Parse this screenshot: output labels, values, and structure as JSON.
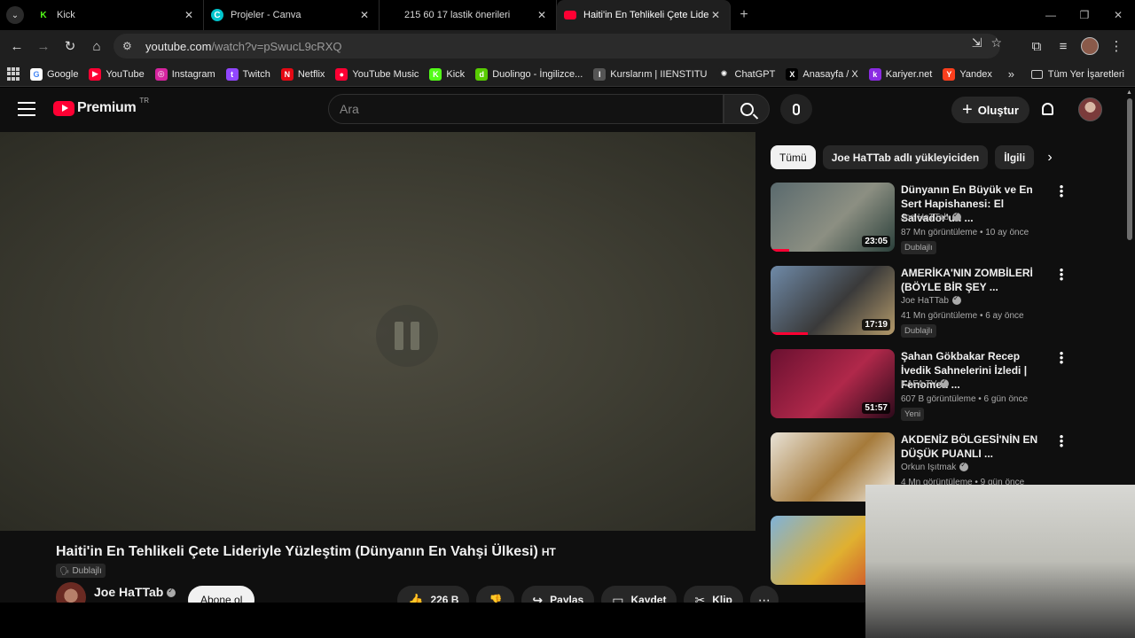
{
  "browser": {
    "tabs": [
      {
        "title": "Kick",
        "favicon_label": "K",
        "favicon_color": "#53fc18",
        "active": false
      },
      {
        "title": "Projeler - Canva",
        "favicon_label": "C",
        "favicon_color": "#00c4cc",
        "active": false
      },
      {
        "title": "215 60 17 lastik önerileri",
        "favicon_label": "",
        "favicon_color": "#000000",
        "active": false
      },
      {
        "title": "Haiti'in En Tehlikeli Çete Lideriy",
        "favicon_label": "",
        "favicon_color": "#ff0033",
        "active": true
      }
    ],
    "url_host": "youtube.com",
    "url_path": "/watch?v=pSwucL9cRXQ",
    "bookmarks": [
      {
        "label": "Google",
        "icon_color": "#ffffff",
        "icon_label": "G"
      },
      {
        "label": "YouTube",
        "icon_color": "#ff0033",
        "icon_label": "▶"
      },
      {
        "label": "Instagram",
        "icon_color": "#d6249f",
        "icon_label": "◎"
      },
      {
        "label": "Twitch",
        "icon_color": "#9146ff",
        "icon_label": "t"
      },
      {
        "label": "Netflix",
        "icon_color": "#e50914",
        "icon_label": "N"
      },
      {
        "label": "YouTube Music",
        "icon_color": "#ff0033",
        "icon_label": "●"
      },
      {
        "label": "Kick",
        "icon_color": "#53fc18",
        "icon_label": "K"
      },
      {
        "label": "Duolingo - İngilizce...",
        "icon_color": "#58cc02",
        "icon_label": "d"
      },
      {
        "label": "Kurslarım | IIENSTITU",
        "icon_color": "#555555",
        "icon_label": "I"
      },
      {
        "label": "ChatGPT",
        "icon_color": "#1f1f1f",
        "icon_label": "✺"
      },
      {
        "label": "Anasayfa / X",
        "icon_color": "#000000",
        "icon_label": "X"
      },
      {
        "label": "Kariyer.net",
        "icon_color": "#8a2be2",
        "icon_label": "k"
      },
      {
        "label": "Yandex",
        "icon_color": "#fc3f1d",
        "icon_label": "Y"
      }
    ],
    "bookmarks_more": "»",
    "all_bookmarks": "Tüm Yer İşaretleri"
  },
  "youtube": {
    "logo_word": "Premium",
    "country_code": "TR",
    "search_placeholder": "Ara",
    "create_label": "Oluştur",
    "video": {
      "title": "Haiti'in En Tehlikeli Çete Lideriyle Yüzleştim (Dünyanın En Vahşi Ülkesi)",
      "hashtag": "HT",
      "dub_badge": "Dublajlı",
      "channel": "Joe HaTTab",
      "subscribe": "Abone ol",
      "likes": "226 B",
      "share": "Paylaş",
      "save": "Kaydet",
      "clip": "Klip"
    },
    "chips": [
      "Tümü",
      "Joe HaTTab adlı yükleyiciden",
      "İlgili"
    ],
    "recommendations": [
      {
        "title": "Dünyanın En Büyük ve En Sert Hapishanesi: El Salvador'un ...",
        "channel": "Joe HaTTab",
        "verified": true,
        "meta": "87 Mn görüntüleme • 10 ay önce",
        "badge": "Dublajlı",
        "duration": "23:05",
        "progress": 0.15,
        "thumb_colors": [
          "#5a6a6e",
          "#8c8f82",
          "#2a3f3a"
        ]
      },
      {
        "title": "AMERİKA'NIN ZOMBİLERİ (BÖYLE BİR ŞEY ...",
        "channel": "Joe HaTTab",
        "verified": true,
        "meta": "41 Mn görüntüleme • 6 ay önce",
        "badge": "Dublajlı",
        "duration": "17:19",
        "progress": 0.3,
        "thumb_colors": [
          "#6f8aa8",
          "#3a3a3a",
          "#b49a6a"
        ]
      },
      {
        "title": "Şahan Gökbakar Recep İvedik Sahnelerini İzledi | Fenomen ...",
        "channel": "KAFA TV",
        "verified": true,
        "meta": "607 B görüntüleme • 6 gün önce",
        "badge": "Yeni",
        "duration": "51:57",
        "progress": 0,
        "thumb_colors": [
          "#6a1030",
          "#b0284a",
          "#2b0a1a"
        ]
      },
      {
        "title": "AKDENİZ BÖLGESİ'NİN EN DÜŞÜK PUANLI ...",
        "channel": "Orkun Işıtmak",
        "verified": true,
        "meta": "4 Mn görüntüleme • 9 gün önce",
        "badge": "",
        "duration": "",
        "progress": 0,
        "thumb_colors": [
          "#e8e2d6",
          "#a57a3a",
          "#f2efe8"
        ]
      },
      {
        "title": "",
        "channel": "",
        "verified": false,
        "meta": "",
        "badge": "",
        "duration": "",
        "progress": 0,
        "thumb_colors": [
          "#7fb2d9",
          "#e0b030",
          "#c93a2a"
        ]
      }
    ]
  },
  "colors": {
    "brand_red": "#ff0033",
    "bg": "#0f0f0f",
    "chip_bg": "#272727"
  }
}
